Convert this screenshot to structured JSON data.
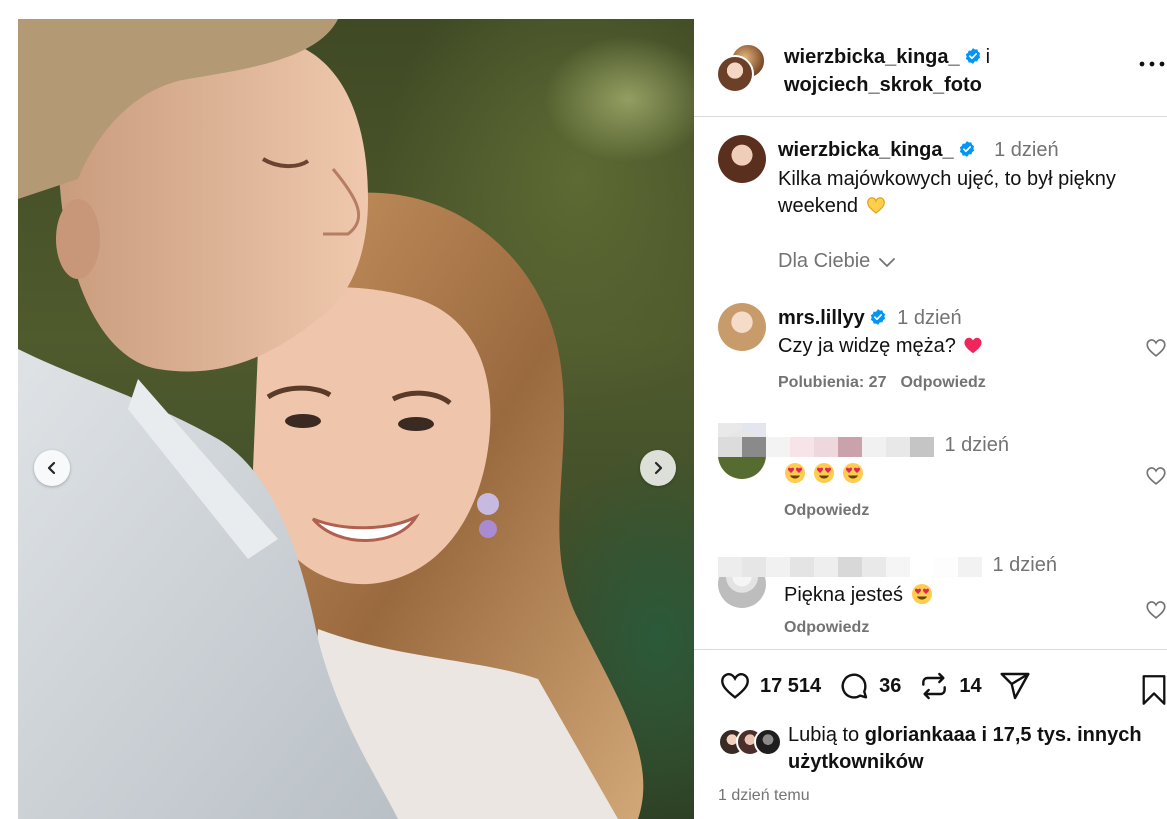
{
  "header": {
    "owner_username": "wierzbicka_kinga_",
    "joiner": "i",
    "collaborator_username": "wojciech_skrok_foto"
  },
  "caption": {
    "username": "wierzbicka_kinga_",
    "time": "1 dzień",
    "text": "Kilka majówkowych ujęć, to był piękny weekend"
  },
  "filter_label": "Dla Ciebie",
  "comments": [
    {
      "username": "mrs.lillyy",
      "time": "1 dzień",
      "text": "Czy ja widzę męża?",
      "likes_label": "Polubienia: 27",
      "reply_label": "Odpowiedz"
    },
    {
      "username": "",
      "time": "1 dzień",
      "text": "",
      "reply_label": "Odpowiedz"
    },
    {
      "username": "",
      "time": "1 dzień",
      "text": "Piękna jesteś",
      "reply_label": "Odpowiedz"
    }
  ],
  "actions": {
    "likes_count": "17 514",
    "comments_count": "36",
    "reposts_count": "14"
  },
  "liked_by": {
    "prefix": "Lubią to",
    "user": "gloriankaaa",
    "suffix": "i 17,5 tys. innych użytkowników"
  },
  "posted_time": "1 dzień temu",
  "icons": {
    "verified": "verified-badge-icon",
    "more": "more-options-icon",
    "chevron": "chevron-down-icon",
    "like": "heart-icon",
    "comment": "comment-icon",
    "repost": "repost-icon",
    "share": "send-icon",
    "save": "bookmark-icon",
    "prev": "chevron-left-icon",
    "next": "chevron-right-icon"
  },
  "colors": {
    "verified": "#0095f6",
    "secondary_text": "#737373",
    "divider": "#dbdbdb",
    "heart_emoji": "#f0265a"
  }
}
